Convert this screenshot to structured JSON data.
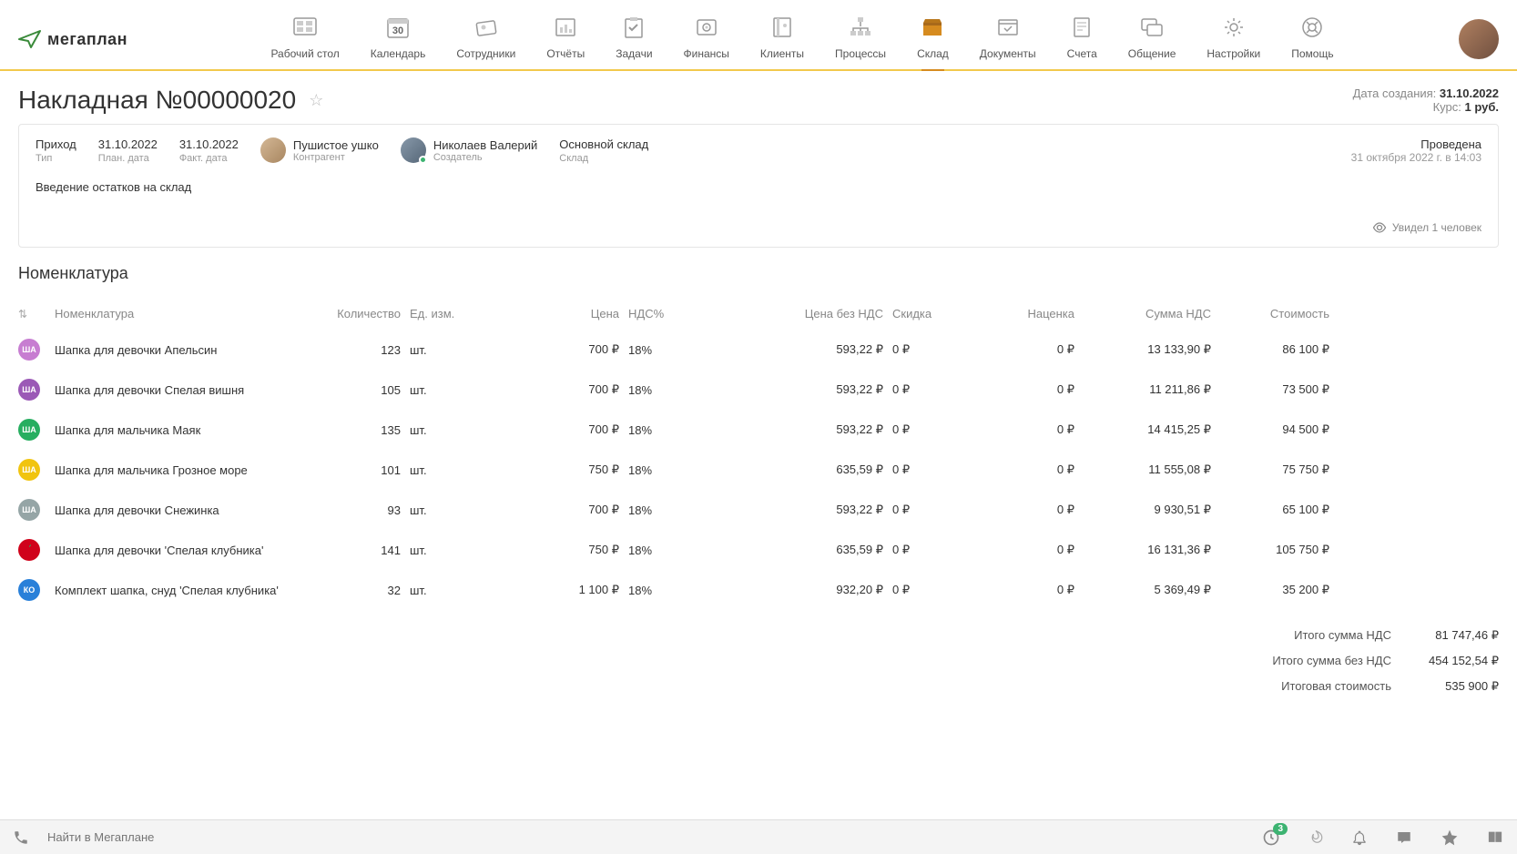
{
  "logo": "мегаплан",
  "nav": [
    {
      "label": "Рабочий стол",
      "id": "dashboard"
    },
    {
      "label": "Календарь",
      "id": "calendar"
    },
    {
      "label": "Сотрудники",
      "id": "employees"
    },
    {
      "label": "Отчёты",
      "id": "reports"
    },
    {
      "label": "Задачи",
      "id": "tasks"
    },
    {
      "label": "Финансы",
      "id": "finance"
    },
    {
      "label": "Клиенты",
      "id": "clients"
    },
    {
      "label": "Процессы",
      "id": "processes"
    },
    {
      "label": "Склад",
      "id": "warehouse",
      "active": true
    },
    {
      "label": "Документы",
      "id": "documents"
    },
    {
      "label": "Счета",
      "id": "invoices"
    },
    {
      "label": "Общение",
      "id": "chat"
    },
    {
      "label": "Настройки",
      "id": "settings"
    },
    {
      "label": "Помощь",
      "id": "help"
    }
  ],
  "title": "Накладная №00000020",
  "created_label": "Дата создания:",
  "created_date": "31.10.2022",
  "rate_label": "Курс:",
  "rate_value": "1 руб.",
  "meta": {
    "type": {
      "val": "Приход",
      "lbl": "Тип"
    },
    "plan_date": {
      "val": "31.10.2022",
      "lbl": "План. дата"
    },
    "fact_date": {
      "val": "31.10.2022",
      "lbl": "Факт. дата"
    },
    "contractor": {
      "val": "Пушистое ушко",
      "lbl": "Контрагент"
    },
    "creator": {
      "val": "Николаев Валерий",
      "lbl": "Создатель"
    },
    "warehouse": {
      "val": "Основной склад",
      "lbl": "Склад"
    },
    "status": {
      "val": "Проведена",
      "datetime": "31 октября 2022 г. в 14:03"
    }
  },
  "description": "Введение остатков на склад",
  "seen_text": "Увидел 1 человек",
  "section_title": "Номенклатура",
  "columns": {
    "name": "Номенклатура",
    "qty": "Количество",
    "unit": "Ед. изм.",
    "price": "Цена",
    "vat": "НДС%",
    "price_no_vat": "Цена без НДС",
    "discount": "Скидка",
    "markup": "Наценка",
    "vat_sum": "Сумма НДС",
    "cost": "Стоимость"
  },
  "rows": [
    {
      "tag": "ША",
      "tag_color": "#c77dd1",
      "name": "Шапка для девочки Апельсин",
      "qty": "123",
      "unit": "шт.",
      "price": "700 ₽",
      "vat": "18%",
      "price_no_vat": "593,22 ₽",
      "discount": "0 ₽",
      "markup": "0 ₽",
      "vat_sum": "13 133,90 ₽",
      "cost": "86 100 ₽"
    },
    {
      "tag": "ША",
      "tag_color": "#9b59b6",
      "name": "Шапка для девочки Спелая вишня",
      "qty": "105",
      "unit": "шт.",
      "price": "700 ₽",
      "vat": "18%",
      "price_no_vat": "593,22 ₽",
      "discount": "0 ₽",
      "markup": "0 ₽",
      "vat_sum": "11 211,86 ₽",
      "cost": "73 500 ₽"
    },
    {
      "tag": "ША",
      "tag_color": "#27ae60",
      "name": "Шапка для мальчика Маяк",
      "qty": "135",
      "unit": "шт.",
      "price": "700 ₽",
      "vat": "18%",
      "price_no_vat": "593,22 ₽",
      "discount": "0 ₽",
      "markup": "0 ₽",
      "vat_sum": "14 415,25 ₽",
      "cost": "94 500 ₽"
    },
    {
      "tag": "ША",
      "tag_color": "#f1c40f",
      "name": "Шапка для мальчика Грозное море",
      "qty": "101",
      "unit": "шт.",
      "price": "750 ₽",
      "vat": "18%",
      "price_no_vat": "635,59 ₽",
      "discount": "0 ₽",
      "markup": "0 ₽",
      "vat_sum": "11 555,08 ₽",
      "cost": "75 750 ₽"
    },
    {
      "tag": "ША",
      "tag_color": "#95a5a6",
      "name": "Шапка для девочки Снежинка",
      "qty": "93",
      "unit": "шт.",
      "price": "700 ₽",
      "vat": "18%",
      "price_no_vat": "593,22 ₽",
      "discount": "0 ₽",
      "markup": "0 ₽",
      "vat_sum": "9 930,51 ₽",
      "cost": "65 100 ₽"
    },
    {
      "tag": "",
      "tag_color": "#d0021b",
      "tag_img": true,
      "name": "Шапка для девочки 'Спелая клубника'",
      "qty": "141",
      "unit": "шт.",
      "price": "750 ₽",
      "vat": "18%",
      "price_no_vat": "635,59 ₽",
      "discount": "0 ₽",
      "markup": "0 ₽",
      "vat_sum": "16 131,36 ₽",
      "cost": "105 750 ₽"
    },
    {
      "tag": "КО",
      "tag_color": "#2980d9",
      "name": "Комплект шапка, снуд 'Спелая клубника'",
      "qty": "32",
      "unit": "шт.",
      "price": "1 100 ₽",
      "vat": "18%",
      "price_no_vat": "932,20 ₽",
      "discount": "0 ₽",
      "markup": "0 ₽",
      "vat_sum": "5 369,49 ₽",
      "cost": "35 200 ₽"
    }
  ],
  "totals": [
    {
      "label": "Итого сумма НДС",
      "value": "81 747,46 ₽"
    },
    {
      "label": "Итого сумма без НДС",
      "value": "454 152,54 ₽"
    },
    {
      "label": "Итоговая стоимость",
      "value": "535 900 ₽"
    }
  ],
  "footer": {
    "search_placeholder": "Найти в Мегаплане",
    "notif_badge": "3"
  }
}
